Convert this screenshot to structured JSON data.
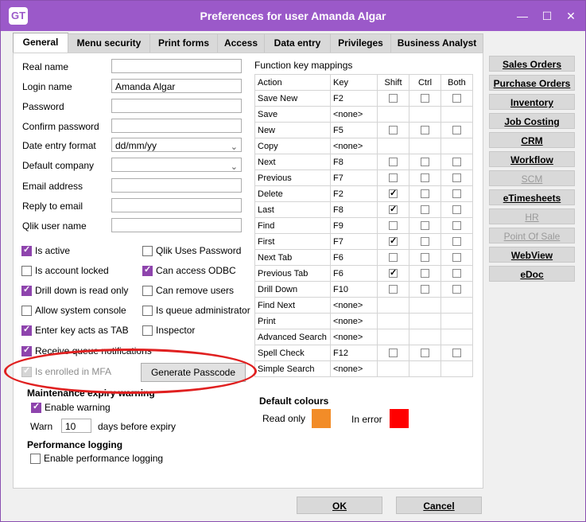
{
  "window": {
    "logo": "GT",
    "title": "Preferences for user Amanda Algar",
    "minimize_glyph": "—",
    "maximize_glyph": "☐",
    "close_glyph": "✕"
  },
  "tabs": [
    {
      "label": "General"
    },
    {
      "label": "Menu security"
    },
    {
      "label": "Print forms"
    },
    {
      "label": "Access"
    },
    {
      "label": "Data entry"
    },
    {
      "label": "Privileges"
    },
    {
      "label": "Business Analyst"
    }
  ],
  "fields": {
    "real_name": {
      "label": "Real name",
      "value": ""
    },
    "login_name": {
      "label": "Login name",
      "value": "Amanda Algar"
    },
    "password": {
      "label": "Password",
      "value": ""
    },
    "confirm_password": {
      "label": "Confirm password",
      "value": ""
    },
    "date_entry_format": {
      "label": "Date entry format",
      "value": "dd/mm/yy"
    },
    "default_company": {
      "label": "Default company",
      "value": ""
    },
    "email_address": {
      "label": "Email address",
      "value": ""
    },
    "reply_to_email": {
      "label": "Reply to email",
      "value": ""
    },
    "qlik_user_name": {
      "label": "Qlik user name",
      "value": ""
    }
  },
  "checkboxes_left": [
    {
      "label": "Is active",
      "checked": true
    },
    {
      "label": "Is account locked",
      "checked": false
    },
    {
      "label": "Drill down is read only",
      "checked": true
    },
    {
      "label": "Allow system console",
      "checked": false
    },
    {
      "label": "Enter key acts as TAB",
      "checked": true
    },
    {
      "label": "Receive queue notifications",
      "checked": true
    },
    {
      "label": "Is enrolled in MFA",
      "checked": true,
      "disabled": true
    }
  ],
  "checkboxes_right": [
    {
      "label": "Qlik Uses Password",
      "checked": false
    },
    {
      "label": "Can access ODBC",
      "checked": true
    },
    {
      "label": "Can remove users",
      "checked": false
    },
    {
      "label": "Is queue administrator",
      "checked": false
    },
    {
      "label": "Inspector",
      "checked": false
    }
  ],
  "generate_passcode_label": "Generate Passcode",
  "maintenance": {
    "title": "Maintenance expiry warning",
    "enable_label": "Enable warning",
    "enable_checked": true,
    "warn_label": "Warn",
    "warn_days": "10",
    "days_suffix": "days before expiry"
  },
  "performance": {
    "title": "Performance logging",
    "enable_label": "Enable performance logging",
    "enable_checked": false
  },
  "function_keys": {
    "title": "Function key mappings",
    "headers": [
      "Action",
      "Key",
      "Shift",
      "Ctrl",
      "Both"
    ],
    "rows": [
      {
        "action": "Save New",
        "key": "F2",
        "has_mod": true,
        "shift": false,
        "ctrl": false,
        "both": false
      },
      {
        "action": "Save",
        "key": "<none>",
        "has_mod": false
      },
      {
        "action": "New",
        "key": "F5",
        "has_mod": true,
        "shift": false,
        "ctrl": false,
        "both": false
      },
      {
        "action": "Copy",
        "key": "<none>",
        "has_mod": false
      },
      {
        "action": "Next",
        "key": "F8",
        "has_mod": true,
        "shift": false,
        "ctrl": false,
        "both": false
      },
      {
        "action": "Previous",
        "key": "F7",
        "has_mod": true,
        "shift": false,
        "ctrl": false,
        "both": false
      },
      {
        "action": "Delete",
        "key": "F2",
        "has_mod": true,
        "shift": true,
        "ctrl": false,
        "both": false
      },
      {
        "action": "Last",
        "key": "F8",
        "has_mod": true,
        "shift": true,
        "ctrl": false,
        "both": false
      },
      {
        "action": "Find",
        "key": "F9",
        "has_mod": true,
        "shift": false,
        "ctrl": false,
        "both": false
      },
      {
        "action": "First",
        "key": "F7",
        "has_mod": true,
        "shift": true,
        "ctrl": false,
        "both": false
      },
      {
        "action": "Next Tab",
        "key": "F6",
        "has_mod": true,
        "shift": false,
        "ctrl": false,
        "both": false
      },
      {
        "action": "Previous Tab",
        "key": "F6",
        "has_mod": true,
        "shift": true,
        "ctrl": false,
        "both": false
      },
      {
        "action": "Drill Down",
        "key": "F10",
        "has_mod": true,
        "shift": false,
        "ctrl": false,
        "both": false
      },
      {
        "action": "Find Next",
        "key": "<none>",
        "has_mod": false
      },
      {
        "action": "Print",
        "key": "<none>",
        "has_mod": false
      },
      {
        "action": "Advanced Search",
        "key": "<none>",
        "has_mod": false
      },
      {
        "action": "Spell Check",
        "key": "F12",
        "has_mod": true,
        "shift": false,
        "ctrl": false,
        "both": false
      },
      {
        "action": "Simple Search",
        "key": "<none>",
        "has_mod": false
      }
    ]
  },
  "default_colours": {
    "title": "Default colours",
    "read_only_label": "Read only",
    "read_only_color": "#f28c28",
    "in_error_label": "In error",
    "in_error_color": "#ff0000"
  },
  "side_buttons": [
    {
      "label": "Sales Orders",
      "enabled": true
    },
    {
      "label": "Purchase Orders",
      "enabled": true
    },
    {
      "label": "Inventory",
      "enabled": true
    },
    {
      "label": "Job Costing",
      "enabled": true
    },
    {
      "label": "CRM",
      "enabled": true
    },
    {
      "label": "Workflow",
      "enabled": true
    },
    {
      "label": "SCM",
      "enabled": false
    },
    {
      "label": "eTimesheets",
      "enabled": true
    },
    {
      "label": "HR",
      "enabled": false
    },
    {
      "label": "Point Of Sale",
      "enabled": false
    },
    {
      "label": "WebView",
      "enabled": true
    },
    {
      "label": "eDoc",
      "enabled": true
    }
  ],
  "ok_label": "OK",
  "cancel_label": "Cancel",
  "colors": {
    "title_bar": "#9b59c9",
    "checkbox_accent": "#8e44ad",
    "annotation": "#e02020"
  }
}
